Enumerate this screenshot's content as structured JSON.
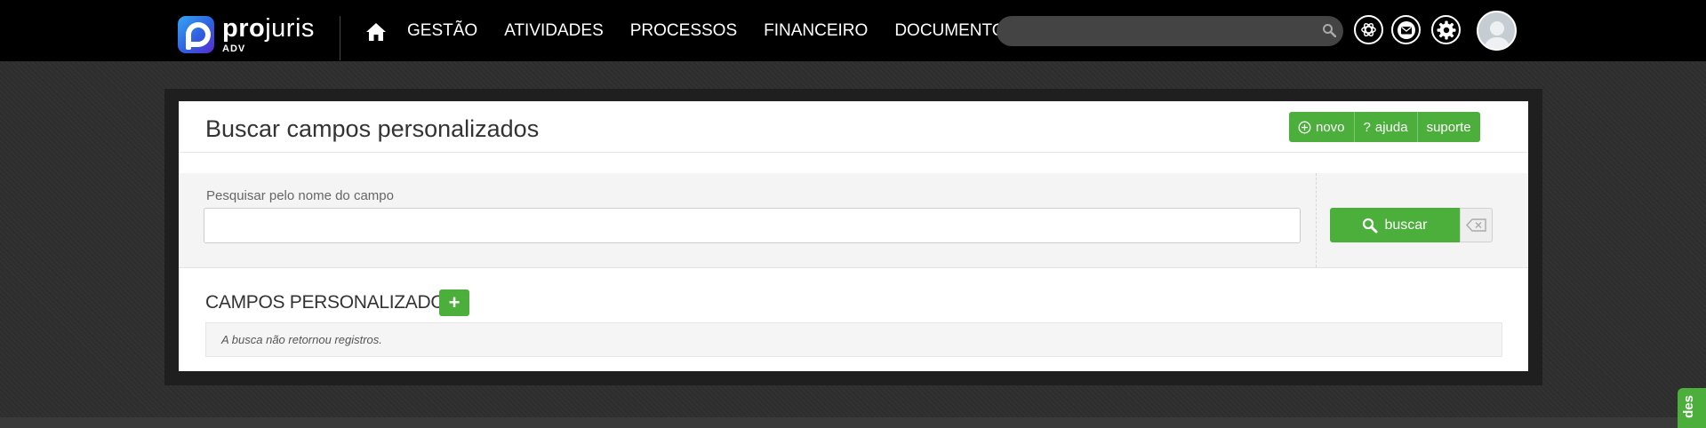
{
  "header": {
    "logo_word_bold": "pro",
    "logo_word_rest": "juris",
    "logo_sub": "ADV",
    "home_icon": "home-icon",
    "nav": [
      "GESTÃO",
      "ATIVIDADES",
      "PROCESSOS",
      "FINANCEIRO",
      "DOCUMENTOS"
    ],
    "search_placeholder": "",
    "icons": [
      "openai-icon",
      "mail-icon",
      "gear-icon"
    ]
  },
  "page": {
    "title": "Buscar campos personalizados",
    "actions": {
      "novo": "novo",
      "ajuda": "ajuda",
      "suporte": "suporte"
    }
  },
  "filter": {
    "label": "Pesquisar pelo nome do campo",
    "value": "",
    "buscar_label": "buscar"
  },
  "results": {
    "section_title": "CAMPOS PERSONALIZADOS",
    "add_label": "+",
    "empty_message": "A busca não retornou registros."
  },
  "side_tab": {
    "label": "des"
  },
  "colors": {
    "accent": "#4caf3c",
    "topbar": "#000000",
    "background": "#2e2e2e"
  }
}
